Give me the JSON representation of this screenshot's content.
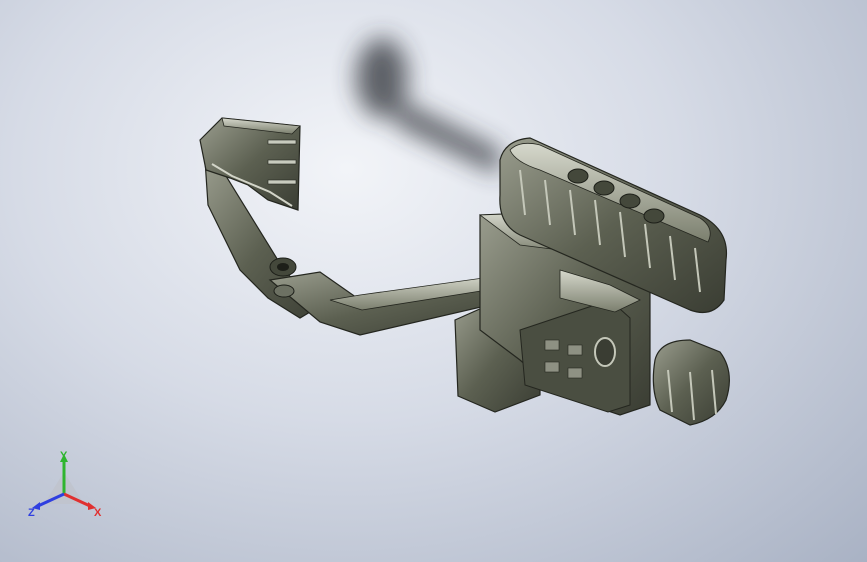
{
  "viewport": {
    "background_top": "#eef1f6",
    "background_bottom": "#a9b2c4",
    "model_color": "#5c6051",
    "model_highlight": "#c9ccc0",
    "model_shadow": "#2f322a"
  },
  "triad": {
    "x_label": "X",
    "y_label": "Y",
    "z_label": "Z",
    "x_color": "#e03030",
    "y_color": "#2fb52f",
    "z_color": "#2f3fe0"
  }
}
